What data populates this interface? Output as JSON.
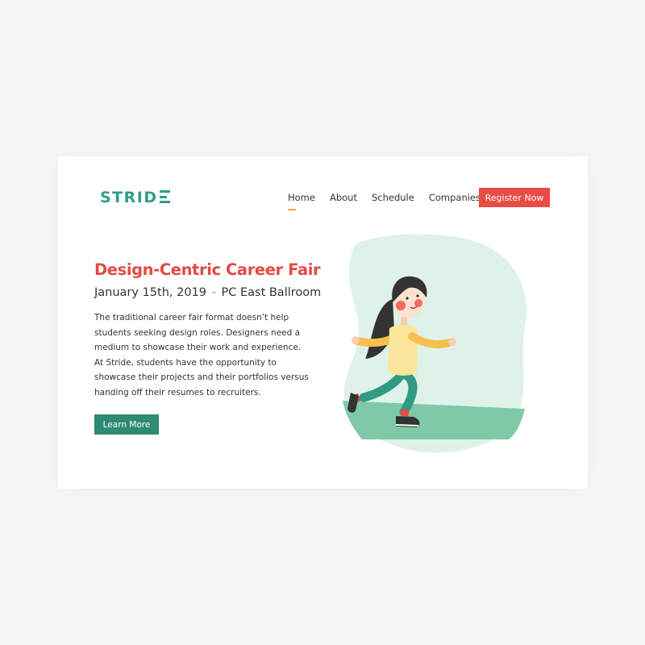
{
  "brand": {
    "logo_text": "STRID",
    "logo_mark_icon": "three-bar-e-icon",
    "primary_color": "#2f9e86",
    "accent_color": "#e84c44"
  },
  "nav": {
    "items": [
      {
        "label": "Home",
        "active": true
      },
      {
        "label": "About"
      },
      {
        "label": "Schedule"
      },
      {
        "label": "Companies"
      }
    ],
    "register_label": "Register Now"
  },
  "hero": {
    "headline": "Design-Centric Career Fair",
    "date": "January 15th, 2019",
    "separator": "-",
    "location": "PC East Ballroom",
    "description": "The traditional career fair format doesn’t help students seeking design roles. Designers need a medium to showcase their work and experience. At Stride, students have the opportunity to showcase their projects and their portfolios versus handing off their resumes to recruiters.",
    "cta_label": "Learn More"
  }
}
